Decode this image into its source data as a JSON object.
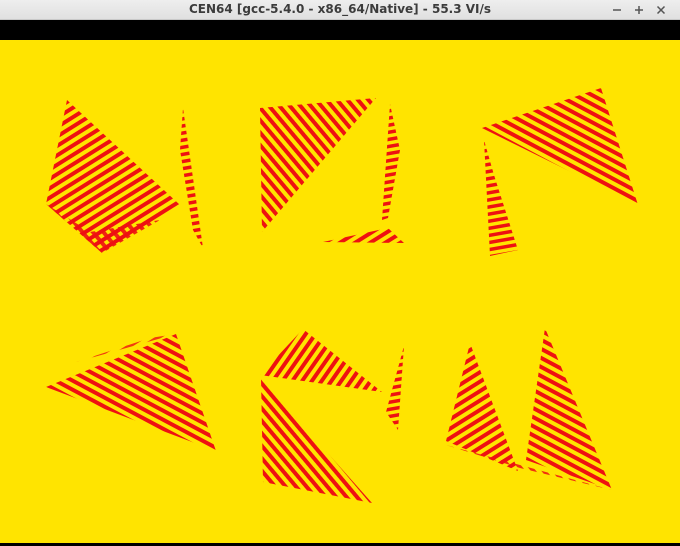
{
  "window": {
    "title": "CEN64 [gcc-5.4.0 - x86_64/Native] - 55.3 VI/s",
    "controls": [
      {
        "name": "minimize-icon"
      },
      {
        "name": "maximize-icon"
      },
      {
        "name": "close-icon"
      }
    ]
  },
  "scene": {
    "background_color": "#ffe400",
    "stripe_color": "#ee1111",
    "shape_count": 6
  }
}
